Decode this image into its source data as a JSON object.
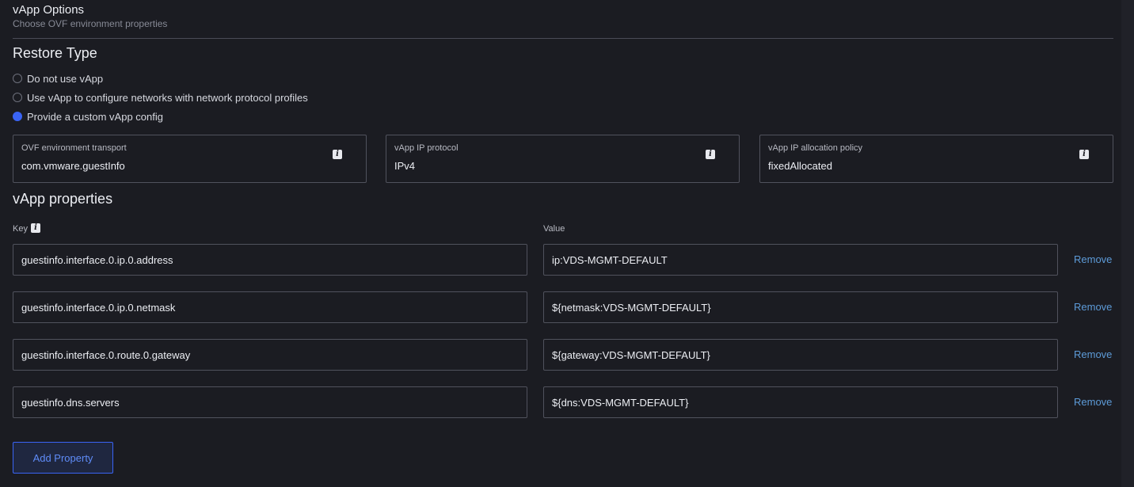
{
  "header": {
    "title": "vApp Options",
    "subtitle": "Choose OVF environment properties"
  },
  "restore_type": {
    "title": "Restore Type",
    "options": [
      {
        "label": "Do not use vApp",
        "checked": false
      },
      {
        "label": "Use vApp to configure networks with network protocol profiles",
        "checked": false
      },
      {
        "label": "Provide a custom vApp config",
        "checked": true
      }
    ]
  },
  "selects": [
    {
      "label": "OVF environment transport",
      "value": "com.vmware.guestInfo",
      "icon": "info-icon"
    },
    {
      "label": "vApp IP protocol",
      "value": "IPv4",
      "icon": "info-icon"
    },
    {
      "label": "vApp IP allocation policy",
      "value": "fixedAllocated",
      "icon": "info-icon"
    }
  ],
  "properties": {
    "title": "vApp properties",
    "key_label": "Key",
    "value_label": "Value",
    "rows": [
      {
        "key": "guestinfo.interface.0.ip.0.address",
        "value": "ip:VDS-MGMT-DEFAULT",
        "remove_label": "Remove"
      },
      {
        "key": "guestinfo.interface.0.ip.0.netmask",
        "value": "${netmask:VDS-MGMT-DEFAULT}",
        "remove_label": "Remove"
      },
      {
        "key": "guestinfo.interface.0.route.0.gateway",
        "value": "${gateway:VDS-MGMT-DEFAULT}",
        "remove_label": "Remove"
      },
      {
        "key": "guestinfo.dns.servers",
        "value": "${dns:VDS-MGMT-DEFAULT}",
        "remove_label": "Remove"
      }
    ],
    "add_button_label": "Add Property"
  },
  "colors": {
    "background": "#1b1c22",
    "accent": "#3a64f5",
    "link": "#5d9bd8"
  }
}
